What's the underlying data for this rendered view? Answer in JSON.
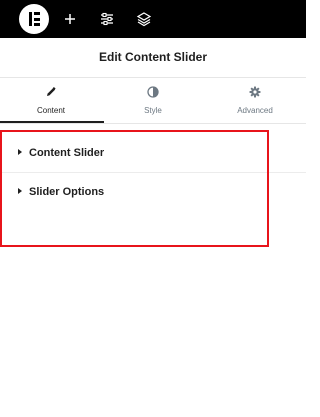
{
  "toolbar": {
    "icons": [
      "elementor-logo",
      "add-icon",
      "settings-sliders-icon",
      "layers-icon"
    ]
  },
  "panel": {
    "title": "Edit Content Slider"
  },
  "tabs": [
    {
      "label": "Content",
      "icon": "pencil-icon",
      "active": true
    },
    {
      "label": "Style",
      "icon": "contrast-icon",
      "active": false
    },
    {
      "label": "Advanced",
      "icon": "gear-icon",
      "active": false
    }
  ],
  "sections": [
    {
      "label": "Content Slider"
    },
    {
      "label": "Slider Options"
    }
  ],
  "colors": {
    "topbar": "#000000",
    "highlight": "#e8141b",
    "text": "#1f1f1f",
    "muted": "#6d7882"
  }
}
